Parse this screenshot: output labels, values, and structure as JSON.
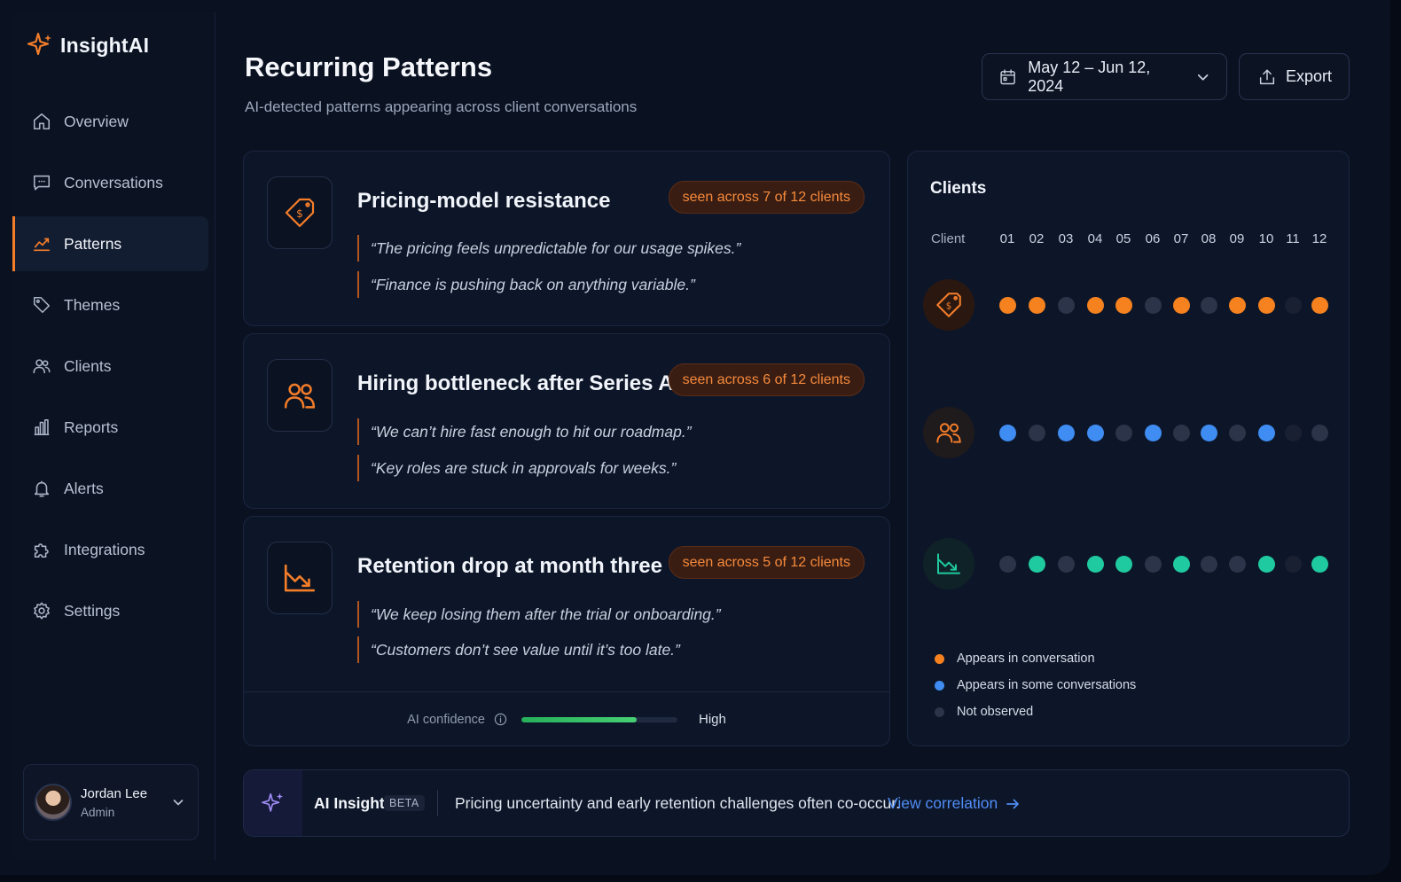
{
  "app": {
    "name": "InsightAI"
  },
  "sidebar": {
    "items": [
      {
        "label": "Overview",
        "icon": "home-icon"
      },
      {
        "label": "Conversations",
        "icon": "chat-icon"
      },
      {
        "label": "Patterns",
        "icon": "trend-icon",
        "active": true
      },
      {
        "label": "Themes",
        "icon": "tag-icon"
      },
      {
        "label": "Clients",
        "icon": "users-icon"
      },
      {
        "label": "Reports",
        "icon": "bar-chart-icon"
      },
      {
        "label": "Alerts",
        "icon": "bell-icon"
      },
      {
        "label": "Integrations",
        "icon": "puzzle-icon"
      },
      {
        "label": "Settings",
        "icon": "gear-icon"
      }
    ],
    "user": {
      "name": "Jordan Lee",
      "role": "Admin"
    }
  },
  "header": {
    "title": "Recurring Patterns",
    "subtitle": "AI-detected patterns appearing across client conversations",
    "date_range": "May 12 – Jun 12, 2024",
    "export_label": "Export"
  },
  "patterns": [
    {
      "title": "Pricing-model resistance",
      "badge": "seen across 7 of 12 clients",
      "icon": "price-tag-icon",
      "quotes": [
        "“The pricing feels unpredictable for our usage spikes.”",
        "“Finance is pushing back on anything variable.”"
      ]
    },
    {
      "title": "Hiring bottleneck after Series A",
      "badge": "seen across 6 of 12 clients",
      "icon": "users-icon",
      "quotes": [
        "“We can’t hire fast enough to hit our roadmap.”",
        "“Key roles are stuck in approvals for weeks.”"
      ]
    },
    {
      "title": "Retention drop at month three",
      "badge": "seen across 5 of 12 clients",
      "icon": "trend-down-icon",
      "quotes": [
        "“We keep losing them after the trial or onboarding.”",
        "“Customers don’t see value until it’s too late.”"
      ]
    }
  ],
  "confidence": {
    "label": "AI confidence",
    "level": "High",
    "value": 0.74
  },
  "clients_panel": {
    "title": "Clients",
    "column_label": "Client",
    "columns": [
      "01",
      "02",
      "03",
      "04",
      "05",
      "06",
      "07",
      "08",
      "09",
      "10",
      "11",
      "12"
    ],
    "rows": [
      {
        "icon": "price-tag-icon",
        "color": "#f5811f",
        "matrix": [
          1,
          1,
          0,
          1,
          1,
          0,
          1,
          0,
          1,
          1,
          0,
          1
        ]
      },
      {
        "icon": "users-icon",
        "color": "#3f8cf2",
        "matrix": [
          1,
          0,
          1,
          1,
          0,
          1,
          0,
          1,
          0,
          1,
          0,
          0
        ]
      },
      {
        "icon": "trend-down-icon",
        "color": "#1fcaa0",
        "matrix": [
          0,
          1,
          0,
          1,
          1,
          0,
          1,
          0,
          0,
          1,
          0,
          1
        ]
      }
    ],
    "legend": [
      {
        "label": "Appears in conversation",
        "color": "#f5811f"
      },
      {
        "label": "Appears in some conversations",
        "color": "#3f8cf2"
      },
      {
        "label": "Not observed",
        "color": "#2b3448"
      }
    ]
  },
  "insight": {
    "label": "AI Insight",
    "badge": "BETA",
    "text": "Pricing uncertainty and early retention challenges often co-occur.",
    "link": "View correlation"
  },
  "colors": {
    "accent": "#f47d2a",
    "background": "#0a1120",
    "link": "#4f8df5"
  }
}
